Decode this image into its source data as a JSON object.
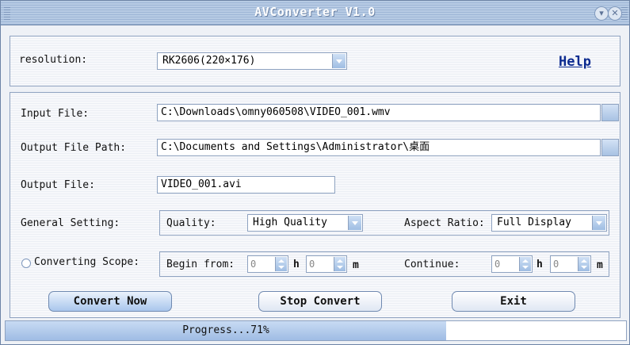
{
  "window": {
    "title": "AVConverter V1.0"
  },
  "header": {
    "resolution_label": "resolution:",
    "resolution_value": "RK2606(220×176)",
    "help_label": "Help"
  },
  "form": {
    "input_file_label": "Input File:",
    "input_file_value": "C:\\Downloads\\omny060508\\VIDEO_001.wmv",
    "output_path_label": "Output File Path:",
    "output_path_value": "C:\\Documents and Settings\\Administrator\\桌面",
    "output_file_label": "Output File:",
    "output_file_value": "VIDEO_001.avi",
    "general_setting_label": "General Setting:",
    "quality_label": "Quality:",
    "quality_value": "High Quality",
    "aspect_label": "Aspect Ratio:",
    "aspect_value": "Full Display",
    "scope_label": "Converting Scope:",
    "begin_label": "Begin from:",
    "begin_h": "0",
    "begin_m": "0",
    "continue_label": "Continue:",
    "continue_h": "0",
    "continue_m": "0",
    "unit_h": "h",
    "unit_m": "m"
  },
  "buttons": {
    "convert": "Convert Now",
    "stop": "Stop Convert",
    "exit": "Exit"
  },
  "status": {
    "progress_text": "Progress...71%",
    "progress_fraction": 0.71
  }
}
